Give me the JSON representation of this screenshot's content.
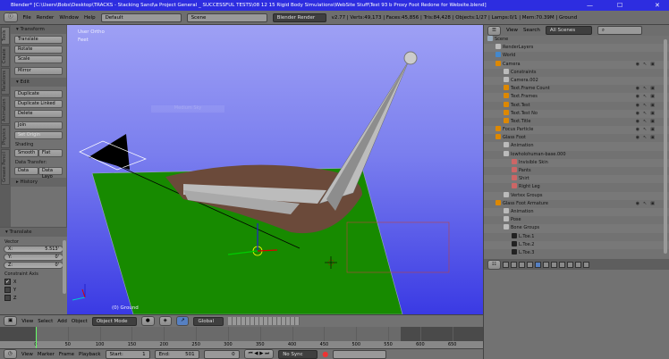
{
  "titlebar": {
    "title": "Blender* [C:\\Users\\Bobs\\Desktop\\TRACKS - Stacking Sand\\a Project General _ SUCCESSFUL TESTS\\08 12 15 Rigid Body Simulations\\WebSite Stuff\\Test 93 b Proxy Foot Redone for Website.blend]",
    "minimize": "—",
    "maximize": "☐",
    "close": "✕"
  },
  "menubar": {
    "menus": [
      "File",
      "Render",
      "Window",
      "Help"
    ],
    "layout": "Default",
    "scene": "Scene",
    "engine": "Blender Render",
    "stats": "v2.77 | Verts:49,173 | Faces:45,856 | Tris:84,428 | Objects:1/27 | Lamps:0/1 | Mem:70.39M | Ground"
  },
  "tabs": [
    "Tools",
    "Create",
    "Relations",
    "Animation",
    "Physics",
    "Grease Pencil"
  ],
  "toolshelf": {
    "transform": {
      "title": "Transform",
      "buttons": [
        "Translate",
        "Rotate",
        "Scale",
        "Mirror"
      ]
    },
    "edit": {
      "title": "Edit",
      "buttons": [
        "Duplicate",
        "Duplicate Linked",
        "Delete",
        "Join"
      ],
      "set_origin": "Set Origin",
      "shading_label": "Shading",
      "smooth": "Smooth",
      "flat": "Flat",
      "data_transfer_label": "Data Transfer:",
      "data": "Data",
      "data_layout": "Data Layo"
    },
    "history": {
      "title": "History"
    }
  },
  "redo": {
    "title": "Translate",
    "vector_label": "Vector",
    "x_label": "X:",
    "x": "5.513'",
    "y_label": "Y:",
    "y": "0'",
    "z_label": "Z:",
    "z": "0'",
    "constraint_label": "Constraint Axis",
    "axes": [
      {
        "label": "X",
        "checked": true
      },
      {
        "label": "Y",
        "checked": false
      },
      {
        "label": "Z",
        "checked": false
      }
    ]
  },
  "viewport": {
    "view_name": "User Ortho",
    "units": "Feet",
    "object_label": "(0) Ground",
    "hint": "Medium Sky"
  },
  "viewport_header": {
    "menus": [
      "View",
      "Select",
      "Add",
      "Object"
    ],
    "mode": "Object Mode",
    "orientation": "Global"
  },
  "timeline": {
    "ticks": [
      "0",
      "50",
      "100",
      "150",
      "200",
      "250",
      "300",
      "350",
      "400",
      "450",
      "500",
      "550",
      "600",
      "650"
    ],
    "current_frame": 0
  },
  "timeline_header": {
    "menus": [
      "View",
      "Marker",
      "Frame",
      "Playback"
    ],
    "start_label": "Start:",
    "start": "1",
    "end_label": "End:",
    "end": "501",
    "current": "0",
    "sync": "No Sync"
  },
  "outliner": {
    "view": "View",
    "search": "Search",
    "filter": "All Scenes",
    "items": [
      {
        "label": "Scene",
        "level": 0,
        "color": "#9ab"
      },
      {
        "label": "RenderLayers",
        "level": 1,
        "color": "#bbb"
      },
      {
        "label": "World",
        "level": 1,
        "color": "#48c"
      },
      {
        "label": "Camera",
        "level": 1,
        "color": "#d80",
        "vis": true
      },
      {
        "label": "Constraints",
        "level": 2,
        "color": "#bbb"
      },
      {
        "label": "Camera.002",
        "level": 2,
        "color": "#bbb"
      },
      {
        "label": "Text.Frame Count",
        "level": 2,
        "color": "#d80",
        "vis": true
      },
      {
        "label": "Text.Frames",
        "level": 2,
        "color": "#d80",
        "vis": true
      },
      {
        "label": "Text.Test",
        "level": 2,
        "color": "#d80",
        "vis": true
      },
      {
        "label": "Text.Test No",
        "level": 2,
        "color": "#d80",
        "vis": true
      },
      {
        "label": "Text.Title",
        "level": 2,
        "color": "#d80",
        "vis": true
      },
      {
        "label": "Focus Particle",
        "level": 1,
        "color": "#d80",
        "vis": true
      },
      {
        "label": "Glass Foot",
        "level": 1,
        "color": "#d80",
        "vis": true
      },
      {
        "label": "Animation",
        "level": 2,
        "color": "#bbb"
      },
      {
        "label": "lowholohuman-base.000",
        "level": 2,
        "color": "#bbb"
      },
      {
        "label": "Invisible Skin",
        "level": 3,
        "color": "#c66"
      },
      {
        "label": "Pants",
        "level": 3,
        "color": "#c66"
      },
      {
        "label": "Shirt",
        "level": 3,
        "color": "#c66"
      },
      {
        "label": "Right Leg",
        "level": 3,
        "color": "#c66"
      },
      {
        "label": "Vertex Groups",
        "level": 2,
        "color": "#bbb"
      },
      {
        "label": "Glass Foot Armature",
        "level": 1,
        "color": "#d80",
        "vis": true
      },
      {
        "label": "Animation",
        "level": 2,
        "color": "#bbb"
      },
      {
        "label": "Pose",
        "level": 2,
        "color": "#bbb"
      },
      {
        "label": "Bone Groups",
        "level": 2,
        "color": "#bbb"
      },
      {
        "label": "L.Toe.1",
        "level": 3,
        "color": "#222"
      },
      {
        "label": "L.Toe.2",
        "level": 3,
        "color": "#222"
      },
      {
        "label": "L.Toe.3",
        "level": 3,
        "color": "#222"
      }
    ]
  },
  "colors": {
    "accent": "#5680c2",
    "titlebar": "#2d2de0",
    "ground": "#1a8a00",
    "viewport_top": "#9ea0f5",
    "viewport_bottom": "#3a3ae4"
  }
}
